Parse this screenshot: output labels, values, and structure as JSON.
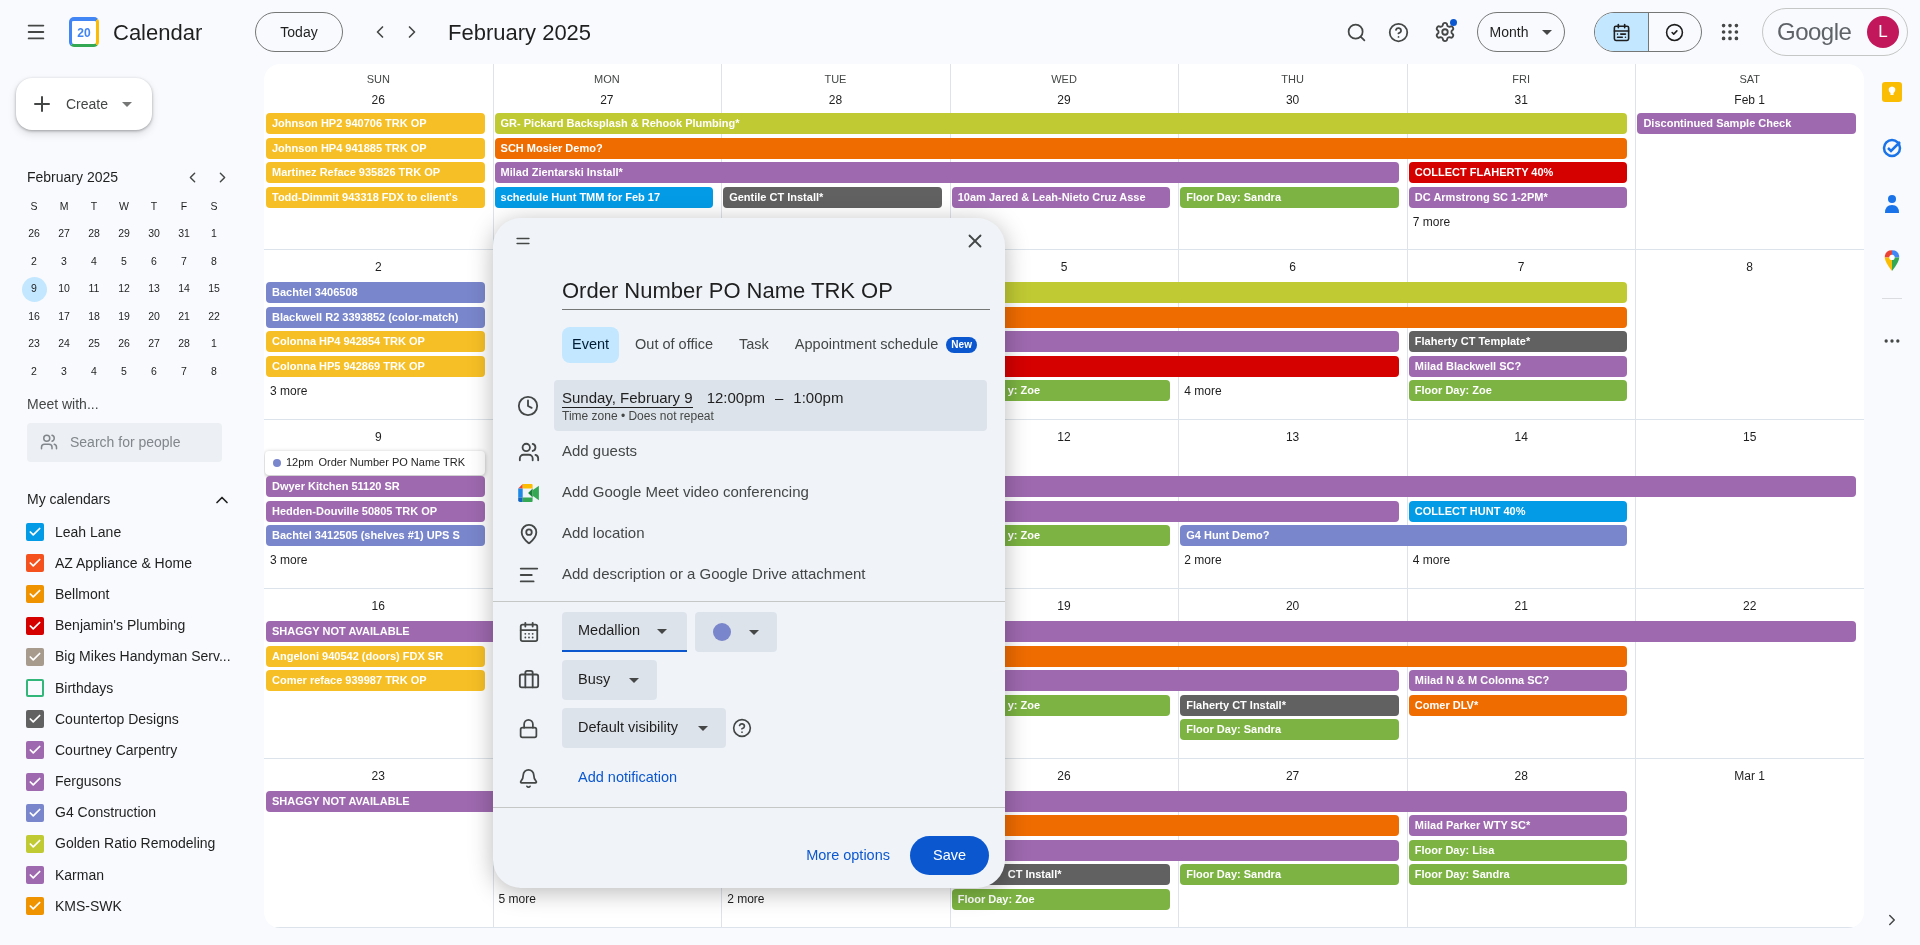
{
  "header": {
    "app_name": "Calendar",
    "logo_day": "20",
    "today_button": "Today",
    "period": "February 2025",
    "view_button": "Month",
    "settings_badge": true,
    "views": [
      {
        "kind": "calendar",
        "selected": true
      },
      {
        "kind": "tasks",
        "selected": false
      }
    ],
    "account": {
      "brand": "Google",
      "initial": "L"
    }
  },
  "sidebar": {
    "create_button": "Create",
    "mini_calendar": {
      "title": "February 2025",
      "weekdays": [
        "S",
        "M",
        "T",
        "W",
        "T",
        "F",
        "S"
      ],
      "weeks": [
        [
          {
            "day": "26",
            "selected": false
          },
          {
            "day": "27",
            "selected": false
          },
          {
            "day": "28",
            "selected": false
          },
          {
            "day": "29",
            "selected": false
          },
          {
            "day": "30",
            "selected": false
          },
          {
            "day": "31",
            "selected": false
          },
          {
            "day": "1",
            "selected": false
          }
        ],
        [
          {
            "day": "2",
            "selected": false
          },
          {
            "day": "3",
            "selected": false
          },
          {
            "day": "4",
            "selected": false
          },
          {
            "day": "5",
            "selected": false
          },
          {
            "day": "6",
            "selected": false
          },
          {
            "day": "7",
            "selected": false
          },
          {
            "day": "8",
            "selected": false
          }
        ],
        [
          {
            "day": "9",
            "selected": true
          },
          {
            "day": "10",
            "selected": false
          },
          {
            "day": "11",
            "selected": false
          },
          {
            "day": "12",
            "selected": false
          },
          {
            "day": "13",
            "selected": false
          },
          {
            "day": "14",
            "selected": false
          },
          {
            "day": "15",
            "selected": false
          }
        ],
        [
          {
            "day": "16",
            "selected": false
          },
          {
            "day": "17",
            "selected": false
          },
          {
            "day": "18",
            "selected": false
          },
          {
            "day": "19",
            "selected": false
          },
          {
            "day": "20",
            "selected": false
          },
          {
            "day": "21",
            "selected": false
          },
          {
            "day": "22",
            "selected": false
          }
        ],
        [
          {
            "day": "23",
            "selected": false
          },
          {
            "day": "24",
            "selected": false
          },
          {
            "day": "25",
            "selected": false
          },
          {
            "day": "26",
            "selected": false
          },
          {
            "day": "27",
            "selected": false
          },
          {
            "day": "28",
            "selected": false
          },
          {
            "day": "1",
            "selected": false
          }
        ],
        [
          {
            "day": "2",
            "selected": false
          },
          {
            "day": "3",
            "selected": false
          },
          {
            "day": "4",
            "selected": false
          },
          {
            "day": "5",
            "selected": false
          },
          {
            "day": "6",
            "selected": false
          },
          {
            "day": "7",
            "selected": false
          },
          {
            "day": "8",
            "selected": false
          }
        ]
      ]
    },
    "meet": {
      "title": "Meet with...",
      "placeholder": "Search for people"
    },
    "my_calendars": {
      "title": "My calendars",
      "expanded": true,
      "items": [
        {
          "name": "Leah Lane",
          "checked": true,
          "color": "#039be5"
        },
        {
          "name": "AZ Appliance & Home",
          "checked": true,
          "color": "#f4511e"
        },
        {
          "name": "Bellmont",
          "checked": true,
          "color": "#f09300"
        },
        {
          "name": "Benjamin's Plumbing",
          "checked": true,
          "color": "#d50000"
        },
        {
          "name": "Big Mikes Handyman Serv...",
          "checked": true,
          "color": "#a79b8e"
        },
        {
          "name": "Birthdays",
          "checked": false,
          "color": "#33b679"
        },
        {
          "name": "Countertop Designs",
          "checked": true,
          "color": "#616161"
        },
        {
          "name": "Courtney Carpentry",
          "checked": true,
          "color": "#9e69af"
        },
        {
          "name": "Fergusons",
          "checked": true,
          "color": "#9e69af"
        },
        {
          "name": "G4 Construction",
          "checked": true,
          "color": "#7986cb"
        },
        {
          "name": "Golden Ratio Remodeling",
          "checked": true,
          "color": "#c0ca33"
        },
        {
          "name": "Karman",
          "checked": true,
          "color": "#9e69af"
        },
        {
          "name": "KMS-SWK",
          "checked": true,
          "color": "#f09300"
        }
      ]
    }
  },
  "month_grid": {
    "weeks": [
      {
        "weekdays": [
          "SUN",
          "MON",
          "TUE",
          "WED",
          "THU",
          "FRI",
          "SAT"
        ],
        "dates": [
          {
            "kind": "date",
            "text": "26"
          },
          {
            "kind": "date",
            "text": "27"
          },
          {
            "kind": "date",
            "text": "28"
          },
          {
            "kind": "date",
            "text": "29"
          },
          {
            "kind": "date",
            "text": "30"
          },
          {
            "kind": "date",
            "text": "31"
          },
          {
            "kind": "date",
            "text": "Feb 1"
          }
        ],
        "rows": [
          [
            {
              "kind": "event",
              "color": "#f6bf26",
              "text": "Johnson HP2 940706 TRK OP"
            },
            {
              "kind": "event",
              "color": "#c0ca33",
              "text": "GR- Pickard Backsplash & Rehook Plumbing*"
            },
            {
              "kind": "continues"
            },
            {
              "kind": "continues"
            },
            {
              "kind": "continues"
            },
            {
              "kind": "continues"
            },
            {
              "kind": "event",
              "color": "#9e69af",
              "text": "Discontinued Sample Check"
            }
          ],
          [
            {
              "kind": "event",
              "color": "#f6bf26",
              "text": "Johnson HP4 941885 TRK OP"
            },
            {
              "kind": "event",
              "color": "#ef6c00",
              "text": "SCH Mosier Demo?"
            },
            {
              "kind": "continues"
            },
            {
              "kind": "continues"
            },
            {
              "kind": "continues"
            },
            {
              "kind": "continues"
            },
            ""
          ],
          [
            {
              "kind": "event",
              "color": "#f6bf26",
              "text": "Martinez Reface 935826 TRK OP"
            },
            {
              "kind": "event",
              "color": "#9e69af",
              "text": "Milad Zientarski Install*"
            },
            {
              "kind": "continues"
            },
            {
              "kind": "continues"
            },
            {
              "kind": "continues"
            },
            {
              "kind": "event",
              "color": "#d50000",
              "text": "COLLECT FLAHERTY 40%"
            },
            ""
          ],
          [
            {
              "kind": "event",
              "color": "#f6bf26",
              "text": "Todd-Dimmit 943318 FDX to client's"
            },
            {
              "kind": "event",
              "color": "#039be5",
              "text": "schedule Hunt TMM for Feb 17"
            },
            {
              "kind": "event",
              "color": "#616161",
              "text": "Gentile CT Install*"
            },
            {
              "kind": "event",
              "color": "#9e69af",
              "text": "10am Jared & Leah-Nieto Cruz Asse"
            },
            {
              "kind": "event",
              "color": "#7cb342",
              "text": "Floor Day: Sandra"
            },
            {
              "kind": "event",
              "color": "#9e69af",
              "text": "DC Armstrong SC 1-2PM*"
            },
            ""
          ],
          [
            "",
            "",
            "",
            "",
            "",
            {
              "kind": "more",
              "text": "7 more"
            },
            ""
          ]
        ]
      },
      {
        "dates": [
          {
            "kind": "date",
            "text": "2"
          },
          {
            "kind": "covered"
          },
          {
            "kind": "covered"
          },
          {
            "kind": "date",
            "text": "5"
          },
          {
            "kind": "date",
            "text": "6"
          },
          {
            "kind": "date",
            "text": "7"
          },
          {
            "kind": "date",
            "text": "8"
          }
        ],
        "rows": [
          [
            {
              "kind": "event",
              "color": "#7986cb",
              "text": "Bachtel 3406508"
            },
            {
              "kind": "event",
              "color": "#c0ca33"
            },
            {
              "kind": "continues"
            },
            {
              "kind": "continues"
            },
            {
              "kind": "continues"
            },
            {
              "kind": "continues"
            },
            ""
          ],
          [
            {
              "kind": "event",
              "color": "#7986cb",
              "text": "Blackwell R2 3393852 (color-match)"
            },
            {
              "kind": "event",
              "color": "#ef6c00"
            },
            {
              "kind": "continues"
            },
            {
              "kind": "continues"
            },
            {
              "kind": "continues"
            },
            {
              "kind": "continues"
            },
            ""
          ],
          [
            {
              "kind": "event",
              "color": "#f6bf26",
              "text": "Colonna HP4 942854 TRK OP"
            },
            {
              "kind": "event",
              "color": "#9e69af"
            },
            {
              "kind": "continues"
            },
            {
              "kind": "continues"
            },
            {
              "kind": "continues"
            },
            {
              "kind": "event",
              "color": "#616161",
              "text": "Flaherty CT Template*"
            },
            ""
          ],
          [
            {
              "kind": "event",
              "color": "#f6bf26",
              "text": "Colonna HP5 942869 TRK OP"
            },
            "",
            {
              "kind": "event",
              "color": "#d50000"
            },
            {
              "kind": "continues"
            },
            {
              "kind": "continues"
            },
            {
              "kind": "event",
              "color": "#9e69af",
              "text": "Milad Blackwell SC?"
            },
            ""
          ],
          [
            {
              "kind": "more",
              "text": "3 more"
            },
            "",
            "",
            {
              "kind": "covered-event",
              "color": "#7cb342",
              "text": "y: Zoe"
            },
            {
              "kind": "more",
              "text": "4 more"
            },
            {
              "kind": "event",
              "color": "#7cb342",
              "text": "Floor Day: Zoe"
            },
            ""
          ]
        ]
      },
      {
        "dates": [
          {
            "kind": "date",
            "text": "9"
          },
          {
            "kind": "covered"
          },
          {
            "kind": "covered"
          },
          {
            "kind": "date",
            "text": "12"
          },
          {
            "kind": "date",
            "text": "13"
          },
          {
            "kind": "date",
            "text": "14"
          },
          {
            "kind": "date",
            "text": "15"
          }
        ],
        "rows": [
          [
            {
              "kind": "draft",
              "color": "#7986cb",
              "time": "12pm",
              "text": "Order Number PO Name TRK"
            },
            "",
            "",
            "",
            "",
            "",
            ""
          ],
          [
            {
              "kind": "event",
              "color": "#9e69af",
              "text": "Dwyer Kitchen 51120 SR"
            },
            {
              "kind": "event",
              "color": "#9e69af"
            },
            {
              "kind": "continues"
            },
            {
              "kind": "continues"
            },
            {
              "kind": "continues"
            },
            {
              "kind": "continues"
            },
            {
              "kind": "continues"
            }
          ],
          [
            {
              "kind": "event",
              "color": "#9e69af",
              "text": "Hedden-Douville 50805 TRK OP"
            },
            {
              "kind": "event",
              "color": "#9e69af"
            },
            {
              "kind": "continues"
            },
            {
              "kind": "continues"
            },
            {
              "kind": "continues"
            },
            {
              "kind": "event",
              "color": "#039be5",
              "text": "COLLECT HUNT 40%"
            },
            ""
          ],
          [
            {
              "kind": "event",
              "color": "#7986cb",
              "text": "Bachtel 3412505 (shelves #1) UPS S"
            },
            "",
            "",
            {
              "kind": "covered-event",
              "color": "#7cb342",
              "text": "y: Zoe"
            },
            {
              "kind": "event",
              "color": "#7986cb",
              "text": "G4 Hunt Demo?"
            },
            {
              "kind": "continues"
            },
            ""
          ],
          [
            {
              "kind": "more",
              "text": "3 more"
            },
            "",
            "",
            "",
            {
              "kind": "more",
              "text": "2 more"
            },
            {
              "kind": "more",
              "text": "4 more"
            },
            ""
          ]
        ]
      },
      {
        "dates": [
          {
            "kind": "date",
            "text": "16"
          },
          {
            "kind": "covered"
          },
          {
            "kind": "covered"
          },
          {
            "kind": "date",
            "text": "19"
          },
          {
            "kind": "date",
            "text": "20"
          },
          {
            "kind": "date",
            "text": "21"
          },
          {
            "kind": "date",
            "text": "22"
          }
        ],
        "rows": [
          [
            {
              "kind": "event",
              "color": "#9e69af",
              "text": "SHAGGY NOT AVAILABLE"
            },
            {
              "kind": "continues"
            },
            {
              "kind": "continues"
            },
            {
              "kind": "continues"
            },
            {
              "kind": "continues"
            },
            {
              "kind": "continues"
            },
            {
              "kind": "continues"
            }
          ],
          [
            {
              "kind": "event",
              "color": "#f6bf26",
              "text": "Angeloni 940542 (doors) FDX SR"
            },
            {
              "kind": "event",
              "color": "#ef6c00"
            },
            {
              "kind": "continues"
            },
            {
              "kind": "continues"
            },
            {
              "kind": "continues"
            },
            {
              "kind": "continues"
            },
            ""
          ],
          [
            {
              "kind": "event",
              "color": "#f6bf26",
              "text": "Comer reface 939987 TRK OP"
            },
            {
              "kind": "event",
              "color": "#9e69af"
            },
            {
              "kind": "continues"
            },
            {
              "kind": "continues"
            },
            {
              "kind": "continues"
            },
            {
              "kind": "event",
              "color": "#9e69af",
              "text": "Milad N & M Colonna SC?"
            },
            ""
          ],
          [
            "",
            "",
            "",
            {
              "kind": "covered-event",
              "color": "#7cb342",
              "text": "y: Zoe"
            },
            {
              "kind": "event",
              "color": "#616161",
              "text": "Flaherty CT Install*"
            },
            {
              "kind": "event",
              "color": "#ef6c00",
              "text": "Comer DLV*"
            },
            ""
          ],
          [
            "",
            "",
            "",
            "",
            {
              "kind": "event",
              "color": "#7cb342",
              "text": "Floor Day: Sandra"
            },
            "",
            ""
          ]
        ]
      },
      {
        "dates": [
          {
            "kind": "date",
            "text": "23"
          },
          {
            "kind": "covered"
          },
          {
            "kind": "covered"
          },
          {
            "kind": "date",
            "text": "26"
          },
          {
            "kind": "date",
            "text": "27"
          },
          {
            "kind": "date",
            "text": "28"
          },
          {
            "kind": "date",
            "text": "Mar 1"
          }
        ],
        "rows": [
          [
            {
              "kind": "event",
              "color": "#9e69af",
              "text": "SHAGGY NOT AVAILABLE"
            },
            {
              "kind": "continues"
            },
            {
              "kind": "continues"
            },
            {
              "kind": "continues"
            },
            {
              "kind": "continues"
            },
            {
              "kind": "continues"
            },
            ""
          ],
          [
            "",
            {
              "kind": "event",
              "color": "#ef6c00"
            },
            {
              "kind": "continues"
            },
            {
              "kind": "continues"
            },
            {
              "kind": "continues"
            },
            {
              "kind": "event",
              "color": "#9e69af",
              "text": "Milad Parker WTY SC*"
            },
            ""
          ],
          [
            "",
            {
              "kind": "event",
              "color": "#9e69af"
            },
            {
              "kind": "continues"
            },
            {
              "kind": "continues"
            },
            {
              "kind": "continues"
            },
            {
              "kind": "event",
              "color": "#7cb342",
              "text": "Floor Day: Lisa"
            },
            ""
          ],
          [
            "",
            "",
            "",
            {
              "kind": "covered-event",
              "color": "#616161",
              "text": "CT Install*"
            },
            {
              "kind": "event",
              "color": "#7cb342",
              "text": "Floor Day: Sandra"
            },
            {
              "kind": "event",
              "color": "#7cb342",
              "text": "Floor Day: Sandra"
            },
            ""
          ],
          [
            "",
            {
              "kind": "more",
              "text": "5 more"
            },
            {
              "kind": "more",
              "text": "2 more"
            },
            {
              "kind": "event",
              "color": "#7cb342",
              "text": "Floor Day: Zoe"
            },
            "",
            "",
            ""
          ]
        ]
      }
    ]
  },
  "event_dialog": {
    "title": "Order Number PO Name TRK OP",
    "tabs": [
      {
        "label": "Event",
        "selected": true
      },
      {
        "label": "Out of office",
        "selected": false
      },
      {
        "label": "Task",
        "selected": false
      },
      {
        "label": "Appointment schedule",
        "selected": false,
        "badge": "New"
      }
    ],
    "date": "Sunday, February 9",
    "start_time": "12:00pm",
    "dash": "–",
    "end_time": "1:00pm",
    "recurrence": "Time zone • Does not repeat",
    "options": [
      {
        "kind": "guests",
        "label": "Add guests"
      },
      {
        "kind": "meet",
        "label": "Add Google Meet video conferencing"
      },
      {
        "kind": "location",
        "label": "Add location"
      },
      {
        "kind": "description",
        "label": "Add description or a Google Drive attachment"
      }
    ],
    "calendar": "Medallion",
    "color": "#7986cb",
    "availability": "Busy",
    "visibility": "Default visibility",
    "notification": "Add notification",
    "more_options": "More options",
    "save": "Save"
  }
}
